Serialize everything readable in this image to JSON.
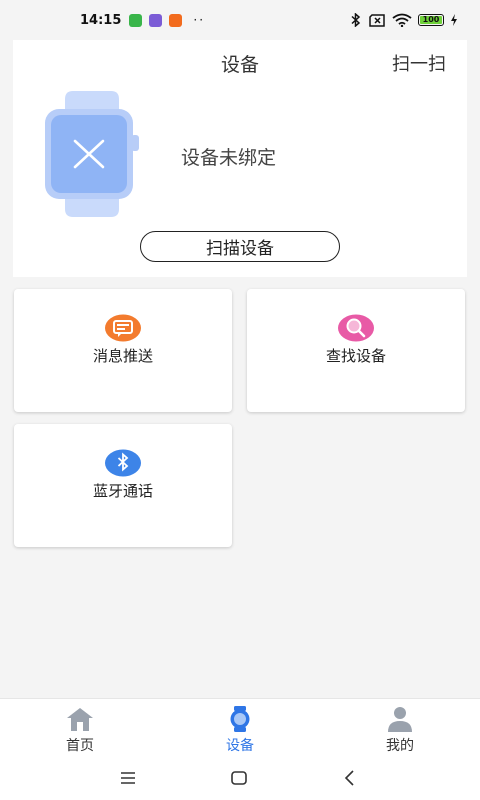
{
  "status_bar": {
    "time": "14:15",
    "dots": "··",
    "battery_level": "100"
  },
  "header": {
    "title": "设备",
    "scan_label": "扫一扫"
  },
  "device": {
    "status_text": "设备未绑定",
    "scan_button_label": "扫描设备"
  },
  "features": [
    {
      "label": "消息推送",
      "icon": "message-icon",
      "color": "#f37b2e"
    },
    {
      "label": "查找设备",
      "icon": "search-icon",
      "color": "#e85aa6"
    },
    {
      "label": "蓝牙通话",
      "icon": "bluetooth-icon",
      "color": "#3d84e8"
    }
  ],
  "bottom_nav": {
    "items": [
      {
        "label": "首页",
        "icon": "home-icon",
        "active": false
      },
      {
        "label": "设备",
        "icon": "watch-icon",
        "active": true
      },
      {
        "label": "我的",
        "icon": "user-icon",
        "active": false
      }
    ]
  },
  "colors": {
    "accent": "#2f76e6",
    "watch_blue": "#8fb4f5",
    "page_bg": "#f4f4f4"
  }
}
